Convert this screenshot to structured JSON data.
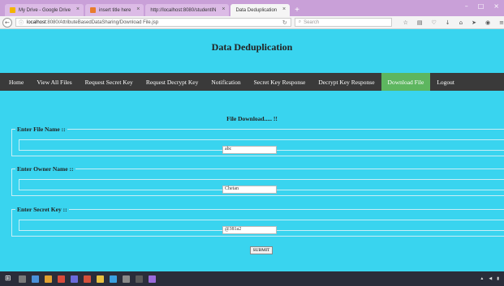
{
  "browser": {
    "tabs": [
      {
        "label": "My Drive - Google Drive",
        "color": "#f4b400"
      },
      {
        "label": "insert title here",
        "color": "#e87c2c"
      },
      {
        "label": "http://localhost:8080/studentIN",
        "color": "#999999"
      },
      {
        "label": "Data Deduplication",
        "color": "#999999"
      }
    ],
    "url_host": "localhost",
    "url_path": ":8080/AttributeBasedDataSharing/Download File.jsp",
    "search_placeholder": "Search"
  },
  "site": {
    "title": "Data Deduplication",
    "menu": [
      "Home",
      "View All Files",
      "Request Secret Key",
      "Request Decrypt Key",
      "Notification",
      "Secret Key Response",
      "Decrypt Key Response",
      "Download File",
      "Logout"
    ],
    "active_menu": "Download File"
  },
  "form": {
    "heading": "File Download..... !!",
    "file_name_legend": "Enter File Name ::",
    "file_name_value": "abc",
    "owner_legend": "Enter Owner Name ::",
    "owner_value": "Chetan",
    "secret_legend": "Enter Secret Key ::",
    "secret_value": "@381a2",
    "submit_label": "SUBMIT"
  },
  "colors": {
    "page_bg": "#39d4ef",
    "menu_bg": "#3a3a3a",
    "active_menu": "#5db65f"
  }
}
